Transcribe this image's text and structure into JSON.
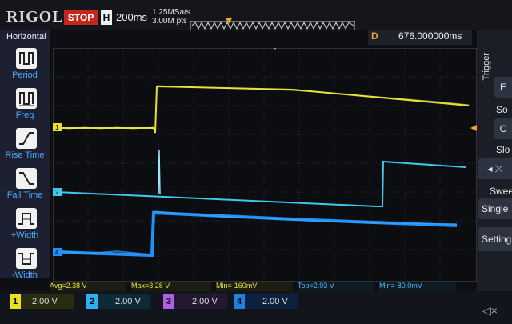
{
  "header": {
    "brand": "RIGOL",
    "status": "STOP",
    "h_label": "H",
    "timebase": "200ms",
    "sample_rate": "1.25MSa/s",
    "mem_depth": "3.00M pts",
    "delay_label": "D",
    "delay_value": "676.000000ms",
    "trigger_label": "T"
  },
  "left_menu": {
    "title": "Horizontal",
    "items": [
      {
        "label": "Period",
        "icon": "period-icon"
      },
      {
        "label": "Freq",
        "icon": "freq-icon"
      },
      {
        "label": "Rise Time",
        "icon": "rise-time-icon"
      },
      {
        "label": "Fall Time",
        "icon": "fall-time-icon"
      },
      {
        "label": "+Width",
        "icon": "pos-width-icon"
      },
      {
        "label": "-Width",
        "icon": "neg-width-icon"
      }
    ]
  },
  "right_menu": {
    "trigger": "Trigger",
    "btn1": "E",
    "sou": "So",
    "btn2": "C",
    "slope": "Slo",
    "sweep": "Swee",
    "sweep_val": "Single",
    "setting": "Setting"
  },
  "measurements": [
    {
      "text": "Avg=2.38 V",
      "color": "yellow"
    },
    {
      "text": "Max=3.28 V",
      "color": "yellow"
    },
    {
      "text": "Min=-160mV",
      "color": "yellow"
    },
    {
      "text": "Top=2.93 V",
      "color": "blue"
    },
    {
      "text": "Min=-80.0mV",
      "color": "blue"
    }
  ],
  "channels": [
    {
      "num": "1",
      "volts": "2.00 V",
      "color": "#e8e020"
    },
    {
      "num": "2",
      "volts": "2.00 V",
      "color": "#30b0f0"
    },
    {
      "num": "3",
      "volts": "2.00 V",
      "color": "#b060e0"
    },
    {
      "num": "4",
      "volts": "2.00 V",
      "color": "#2080e0"
    }
  ],
  "markers": {
    "ch1": "1",
    "ch2": "2",
    "ch4": "4"
  },
  "colors": {
    "ch1": "#e8e030",
    "ch2": "#40c8f0",
    "ch4": "#1e90ff",
    "trigger": "#f0a030"
  }
}
